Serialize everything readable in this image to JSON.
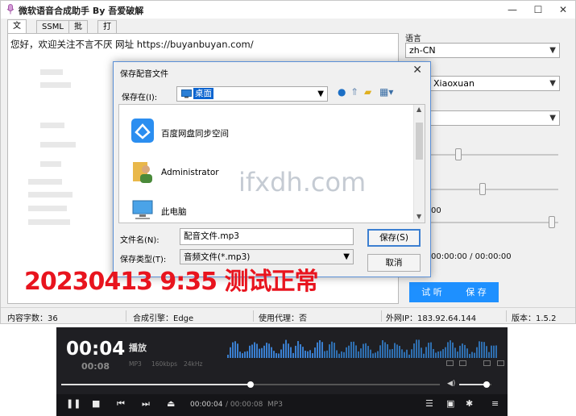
{
  "app": {
    "title": "微软语音合成助手 By 吾爱破解"
  },
  "window_controls": {
    "minimize": "—",
    "maximize": "☐",
    "close": "✕"
  },
  "tabs": [
    "文本",
    "SSML",
    "批量",
    "打赏我"
  ],
  "editor": {
    "text": "您好，欢迎关注不言不厌 网址 https://buyanbuyan.com/"
  },
  "right_panel": {
    "language_label": "语言",
    "language_value": "zh-CN",
    "voice_value": "Xiaoxuan",
    "time_label": "00",
    "time_range": "00:00:00 / 00:00:00",
    "listen_button": "试 听",
    "save_button": "保 存"
  },
  "status_bar": {
    "content_count": "内容字数：36",
    "engine": "合成引擎：Edge",
    "proxy": "使用代理：否",
    "external_ip": "外网IP：183.92.64.144",
    "version": "版本：1.5.2"
  },
  "dialog": {
    "title": "保存配音文件",
    "close": "✕",
    "save_in_label": "保存在(I):",
    "save_in_value": "桌面",
    "items": [
      "百度网盘同步空间",
      "Administrator",
      "此电脑"
    ],
    "filename_label": "文件名(N):",
    "filename_value": "配音文件.mp3",
    "filetype_label": "保存类型(T):",
    "filetype_value": "音频文件(*.mp3)",
    "save_button": "保存(S)",
    "cancel_button": "取消"
  },
  "watermark": "ifxdh.com",
  "stamp": "20230413 9:35 测试正常",
  "player": {
    "current_time": "00:04",
    "total_time": "00:08",
    "title": "播放",
    "format": "MP3",
    "bitrate": "160kbps",
    "samplerate": "24kHz",
    "time_display": "00:00:04",
    "time_total": "/ 00:00:08",
    "format_tag": "MP3",
    "progress": 0.5,
    "volume": 0.85
  },
  "colors": {
    "accent": "#1e90ff",
    "stamp": "#e8141e",
    "player_bg": "#1f1f23",
    "waveform": "#2f6fb0"
  }
}
